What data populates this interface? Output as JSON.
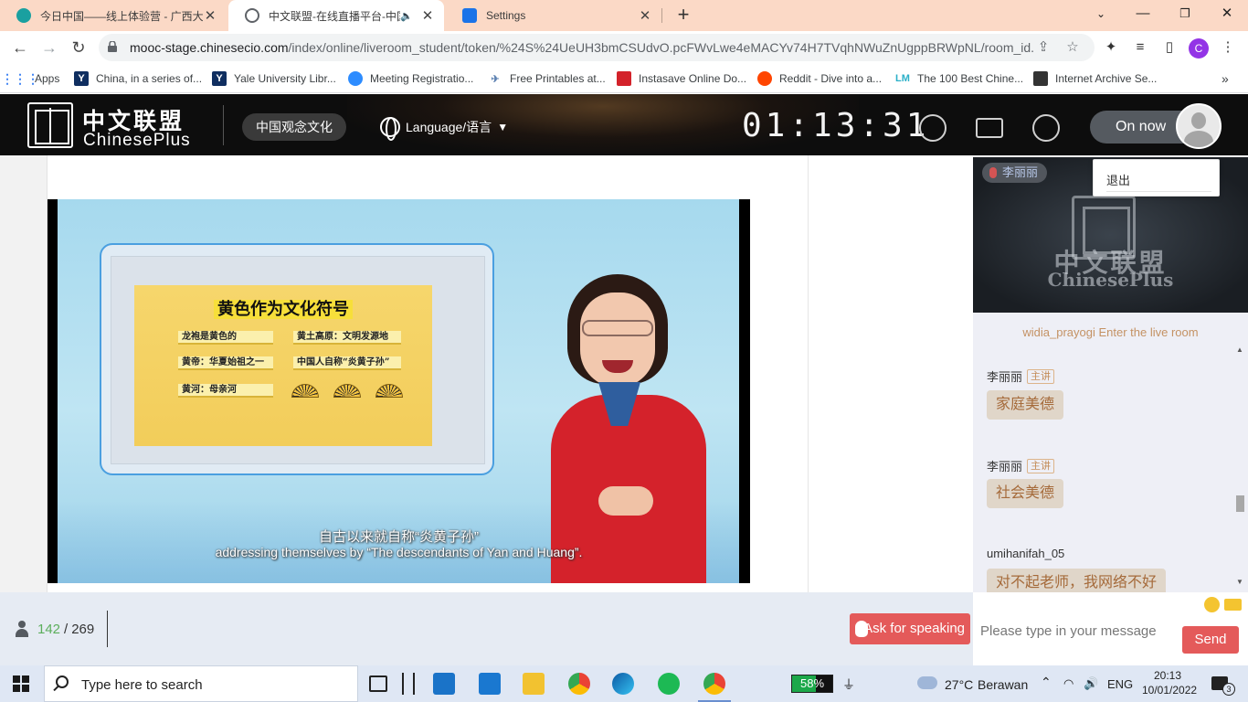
{
  "browser": {
    "tabs": [
      {
        "title": "今日中国——线上体验营 - 广西大",
        "favicon_color": "#1aa0a0"
      },
      {
        "title": "中文联盟-在线直播平台-中国",
        "favicon_color": "#5f6368"
      },
      {
        "title": "Settings",
        "favicon_color": "#1a73e8"
      }
    ],
    "url_host": "mooc-stage.chinesecio.com",
    "url_path": "/index/online/liveroom_student/token/%24S%24UeUH3bmCSUdvO.pcFWvLwe4eMACYv74H7TVqhNWuZnUgppBRWpNL/room_id...",
    "profile_initial": "C",
    "bookmarks": [
      {
        "label": "Apps",
        "icon": "apps-grid-icon",
        "color": "#4285f4"
      },
      {
        "label": "China, in a series of...",
        "icon": "yale-icon",
        "color": "#0f2e60"
      },
      {
        "label": "Yale University Libr...",
        "icon": "yale-icon",
        "color": "#0f2e60"
      },
      {
        "label": "Meeting Registratio...",
        "icon": "zoom-icon",
        "color": "#2d8cff"
      },
      {
        "label": "Free Printables at...",
        "icon": "bird-icon",
        "color": "#5a7fb0"
      },
      {
        "label": "Instasave Online Do...",
        "icon": "instasave-icon",
        "color": "#d3222a"
      },
      {
        "label": "Reddit - Dive into a...",
        "icon": "reddit-icon",
        "color": "#ff4500"
      },
      {
        "label": "The 100 Best Chine...",
        "icon": "lm-icon",
        "color": "#2bb0c8"
      },
      {
        "label": "Internet Archive Se...",
        "icon": "archive-icon",
        "color": "#333333"
      }
    ]
  },
  "site": {
    "logo_cn": "中文联盟",
    "logo_en": "ChinesePlus",
    "course": "中国观念文化",
    "language": "Language/语言",
    "timer": "01:13:31",
    "on_now": "On now",
    "logout": "退出"
  },
  "video": {
    "slide_title": "黄色作为文化符号",
    "slide_items": [
      "龙袍是黄色的",
      "黄土高原：文明发源地",
      "黄帝：华夏始祖之一",
      "中国人自称“炎黄子孙”",
      "黄河：母亲河"
    ],
    "subtitle_cn": "自古以来就自称“炎黄子孙”",
    "subtitle_en": "addressing themselves by “The descendants of Yan and Huang”."
  },
  "camera": {
    "host_name": "李丽丽",
    "logo_cn": "中文联盟",
    "logo_en": "ChinesePlus"
  },
  "chat": {
    "enter_notice": "widia_prayogi Enter the live room",
    "messages": [
      {
        "name": "李丽丽",
        "role": "主讲",
        "text": "家庭美德"
      },
      {
        "name": "李丽丽",
        "role": "主讲",
        "text": "社会美德"
      },
      {
        "name": "umihanifah_05",
        "role": "",
        "text": "对不起老师，我网络不好"
      }
    ],
    "placeholder": "Please type in your message",
    "send": "Send"
  },
  "footer": {
    "online": "142",
    "total": "269",
    "ask": "Ask for speaking"
  },
  "taskbar": {
    "search": "Type here to search",
    "battery": "58%",
    "battery_level": 0.58,
    "temperature": "27°C",
    "weather": "Berawan",
    "lang": "ENG",
    "time": "20:13",
    "date": "10/01/2022",
    "notifications": "3"
  }
}
